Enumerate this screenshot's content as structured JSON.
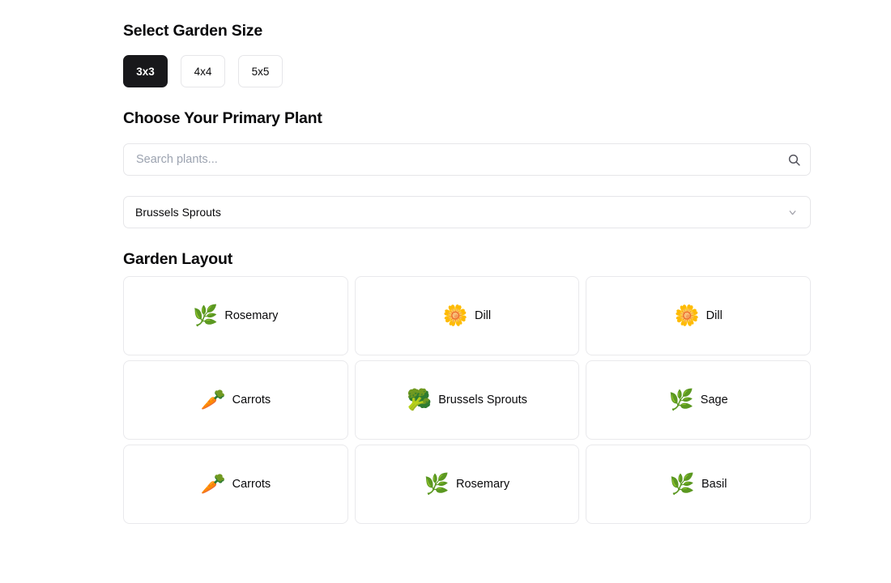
{
  "theme": {
    "background": "#ffffff",
    "text": "#09090b",
    "border": "#e6e6e9",
    "active_bg": "#18181b",
    "active_fg": "#ffffff",
    "placeholder": "#9ca3b0",
    "icon": "#52525b",
    "chevron": "#a1a1aa"
  },
  "size_section": {
    "heading": "Select Garden Size",
    "options": [
      {
        "label": "3x3",
        "selected": true
      },
      {
        "label": "4x4",
        "selected": false
      },
      {
        "label": "5x5",
        "selected": false
      }
    ]
  },
  "plant_section": {
    "heading": "Choose Your Primary Plant",
    "search": {
      "placeholder": "Search plants...",
      "value": "",
      "icon": "search-icon"
    },
    "select": {
      "value": "Brussels Sprouts",
      "icon": "chevron-down-icon"
    }
  },
  "layout_section": {
    "heading": "Garden Layout",
    "rows": 3,
    "columns": 3,
    "cells": [
      {
        "plant": "Rosemary",
        "emoji": "🌿",
        "icon": "rosemary-sprig-icon"
      },
      {
        "plant": "Dill",
        "emoji": "🌼",
        "icon": "dill-flower-icon"
      },
      {
        "plant": "Dill",
        "emoji": "🌼",
        "icon": "dill-flower-icon"
      },
      {
        "plant": "Carrots",
        "emoji": "🥕",
        "icon": "carrot-icon"
      },
      {
        "plant": "Brussels Sprouts",
        "emoji": "🥦",
        "icon": "brussels-sprouts-icon"
      },
      {
        "plant": "Sage",
        "emoji": "🌿",
        "icon": "sage-leaf-icon"
      },
      {
        "plant": "Carrots",
        "emoji": "🥕",
        "icon": "carrot-icon"
      },
      {
        "plant": "Rosemary",
        "emoji": "🌿",
        "icon": "rosemary-sprig-icon"
      },
      {
        "plant": "Basil",
        "emoji": "🌿",
        "icon": "basil-leaf-icon"
      }
    ]
  }
}
